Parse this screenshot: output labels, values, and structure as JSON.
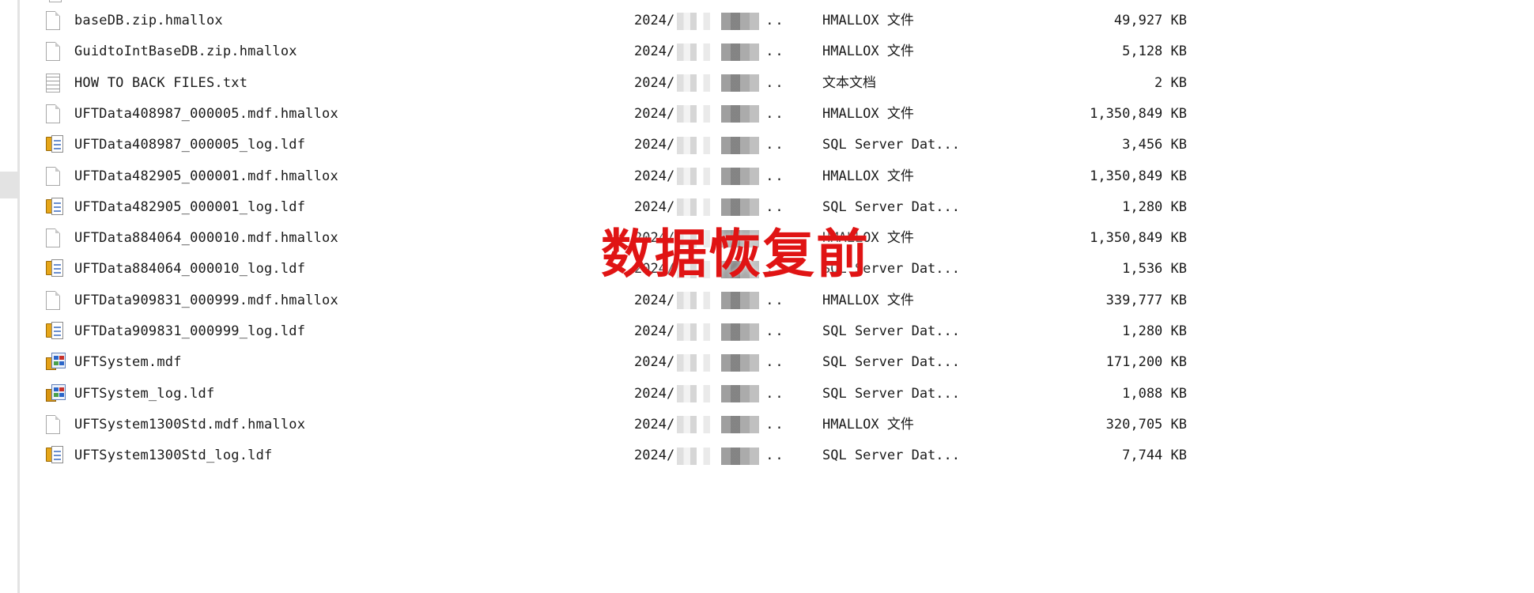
{
  "overlay_label": "数据恢复前",
  "files": [
    {
      "icon": "file-icon",
      "name": "baseDB.zip.hmallox",
      "date": "2024/",
      "type": "HMALLOX 文件",
      "size": "49,927 KB"
    },
    {
      "icon": "file-icon",
      "name": "GuidtoIntBaseDB.zip.hmallox",
      "date": "2024/",
      "type": "HMALLOX 文件",
      "size": "5,128 KB"
    },
    {
      "icon": "text-file-icon",
      "name": "HOW TO BACK FILES.txt",
      "date": "2024/",
      "type": "文本文档",
      "size": "2 KB"
    },
    {
      "icon": "file-icon",
      "name": "UFTData408987_000005.mdf.hmallox",
      "date": "2024/",
      "type": "HMALLOX 文件",
      "size": "1,350,849 KB"
    },
    {
      "icon": "sql-log-icon",
      "name": "UFTData408987_000005_log.ldf",
      "date": "2024/",
      "type": "SQL Server Dat...",
      "size": "3,456 KB"
    },
    {
      "icon": "file-icon",
      "name": "UFTData482905_000001.mdf.hmallox",
      "date": "2024/",
      "type": "HMALLOX 文件",
      "size": "1,350,849 KB"
    },
    {
      "icon": "sql-log-icon",
      "name": "UFTData482905_000001_log.ldf",
      "date": "2024/",
      "type": "SQL Server Dat...",
      "size": "1,280 KB"
    },
    {
      "icon": "file-icon",
      "name": "UFTData884064_000010.mdf.hmallox",
      "date": "2024/",
      "type": "HMALLOX 文件",
      "size": "1,350,849 KB"
    },
    {
      "icon": "sql-log-icon",
      "name": "UFTData884064_000010_log.ldf",
      "date": "2024/",
      "type": "SQL Server Dat...",
      "size": "1,536 KB"
    },
    {
      "icon": "file-icon",
      "name": "UFTData909831_000999.mdf.hmallox",
      "date": "2024/",
      "type": "HMALLOX 文件",
      "size": "339,777 KB"
    },
    {
      "icon": "sql-log-icon",
      "name": "UFTData909831_000999_log.ldf",
      "date": "2024/",
      "type": "SQL Server Dat...",
      "size": "1,280 KB"
    },
    {
      "icon": "sql-database-icon",
      "name": "UFTSystem.mdf",
      "date": "2024/",
      "type": "SQL Server Dat...",
      "size": "171,200 KB"
    },
    {
      "icon": "sql-system-log-icon",
      "name": "UFTSystem_log.ldf",
      "date": "2024/",
      "type": "SQL Server Dat...",
      "size": "1,088 KB"
    },
    {
      "icon": "file-icon",
      "name": "UFTSystem1300Std.mdf.hmallox",
      "date": "2024/",
      "type": "HMALLOX 文件",
      "size": "320,705 KB"
    },
    {
      "icon": "sql-log-icon",
      "name": "UFTSystem1300Std_log.ldf",
      "date": "2024/",
      "type": "SQL Server Dat...",
      "size": "7,744 KB"
    }
  ],
  "date_suffix": ".."
}
